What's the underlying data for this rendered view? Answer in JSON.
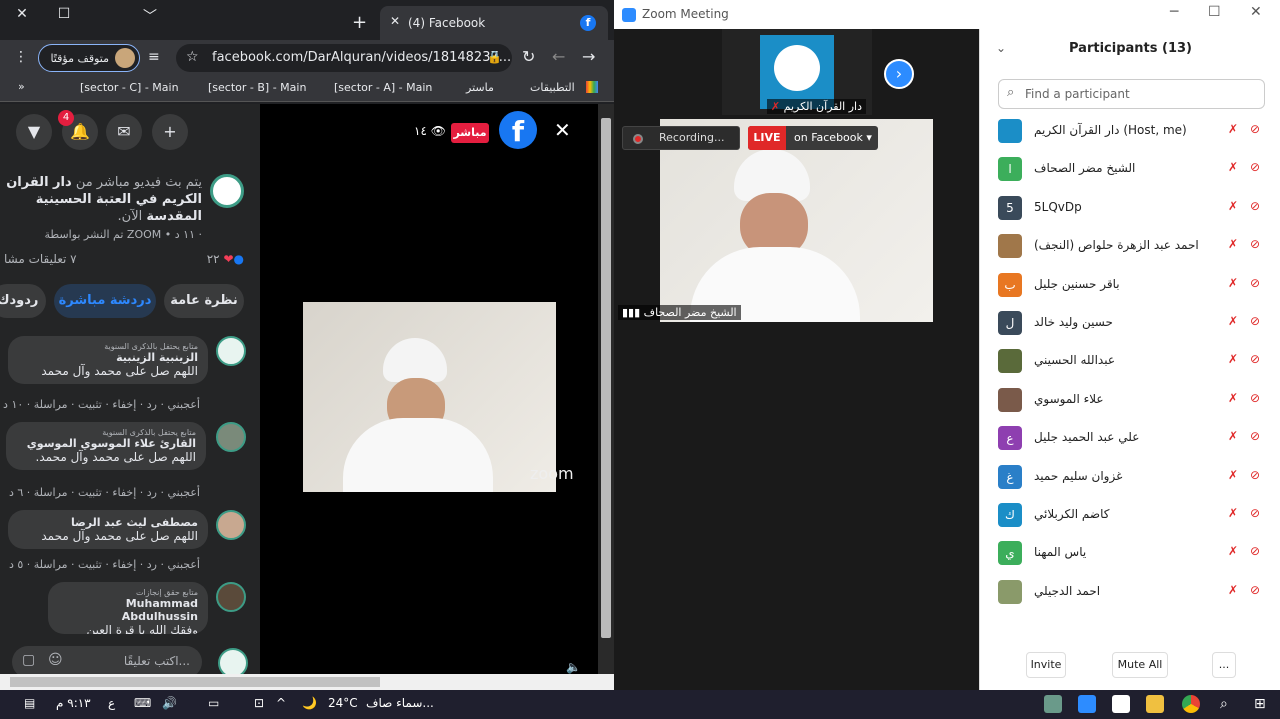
{
  "chrome": {
    "tab_title": "(4) Facebook",
    "new_tab": "+",
    "close": "✕",
    "restore": "☐",
    "minimize": "﹀",
    "url": "facebook.com/DarAlquran/videos/18148237...",
    "paused_label": "متوقف مؤقتًا",
    "bookmarks": [
      "التطبيقات",
      "ماستر",
      "[sector - A] - Main",
      "[sector - B] - Main",
      "[sector - C] - Main"
    ]
  },
  "fb": {
    "notifications_count": "4",
    "desc_prefix": "يتم بث فيديو مباشر من",
    "desc_page": "دار القران الكريم في العتبة الحسينية المقدسة",
    "desc_suffix": "الآن.",
    "meta": "تم النشر بواسطة ZOOM • ١١ د ·",
    "reactions_count": "٢٢",
    "comments_count": "٧ تعليقات  مشا",
    "tabs": [
      "نظرة عامة",
      "دردشة مباشرة",
      "ردودك"
    ],
    "live_label": "مباشر",
    "viewers": "١٤",
    "zoom_watermark": "zoom",
    "comment_placeholder": "اكتب تعليقًا...",
    "comments": [
      {
        "badge": "متابع يحتفل بالذكرى السنوية",
        "name": "الزينبية الزينبية",
        "text": "اللهم صل على محمد وآل محمد",
        "actions": "أعجبني · رد · إخفاء · تثبيت · مراسلة · ١٠ د"
      },
      {
        "badge": "متابع يحتفل بالذكرى السنوية",
        "name": "القارئ علاء الموسوي الموسوي",
        "text": "اللهم صل على محمد وآل محمد.",
        "actions": "أعجبني · رد · إخفاء · تثبيت · مراسلة · ٦ د"
      },
      {
        "badge": "",
        "name": "مصطفى ليث عبد الرضا",
        "text": "اللهم صل على محمد وآل محمد",
        "actions": "أعجبني · رد · إخفاء · تثبيت · مراسلة · ٥ د"
      },
      {
        "badge": "متابع حقق إنجازات",
        "name": "Muhammad Abdulhussin",
        "text": "وفقك الله يا قرة العين",
        "actions": ""
      }
    ]
  },
  "zoom": {
    "title": "Zoom Meeting",
    "host_tile_name": "دار القرآن الكريم",
    "recording": "Recording...",
    "live": "LIVE",
    "live_target": "on Facebook ▾",
    "main_speaker": "الشيخ مضر الصحاف",
    "participants_title": "Participants (13)",
    "search_placeholder": "Find a participant",
    "participants": [
      {
        "initial": "",
        "name": "دار القرآن الكريم (Host, me)",
        "color": "#1b8ec7"
      },
      {
        "initial": "ا",
        "name": "الشيخ مضر الصحاف",
        "color": "#3cae5b"
      },
      {
        "initial": "5",
        "name": "5LQvDp",
        "color": "#3a4a5a"
      },
      {
        "initial": "",
        "name": "احمد عبد الزهرة حلواص (النجف)",
        "color": "#a0774a"
      },
      {
        "initial": "ب",
        "name": "باقر حسنين جليل",
        "color": "#e87722"
      },
      {
        "initial": "ل",
        "name": "حسين وليد خالد",
        "color": "#3a4a5a"
      },
      {
        "initial": "",
        "name": "عبدالله الحسيني",
        "color": "#5a6a3a"
      },
      {
        "initial": "",
        "name": "علاء الموسوي",
        "color": "#7a5a4a"
      },
      {
        "initial": "ع",
        "name": "علي عبد الحميد جليل",
        "color": "#8e3fb0"
      },
      {
        "initial": "غ",
        "name": "غزوان سليم حميد",
        "color": "#2a7fc8"
      },
      {
        "initial": "ك",
        "name": "كاضم الكربلائي",
        "color": "#1b8ec7"
      },
      {
        "initial": "ي",
        "name": "ياس المهنا",
        "color": "#3cae5b"
      },
      {
        "initial": "",
        "name": "احمد الدجيلي",
        "color": "#8a9a6a"
      }
    ],
    "invite": "Invite",
    "mute_all": "Mute All",
    "more": "..."
  },
  "taskbar": {
    "weather": "24°C",
    "weather_desc": "سماء صاف...",
    "lang": "ع",
    "time": "٩:١٣ م"
  }
}
